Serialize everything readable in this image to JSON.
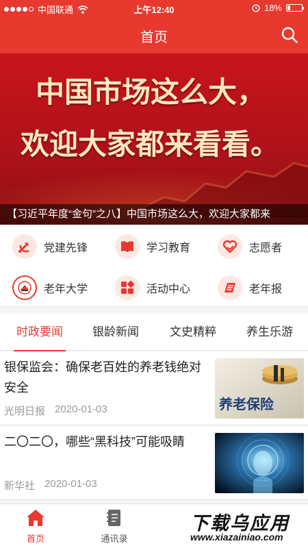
{
  "status_bar": {
    "carrier": "中国联通",
    "time": "上午12:40",
    "battery": "18%"
  },
  "header": {
    "title": "首页"
  },
  "banner": {
    "headline_line1": "中国市场这么大，",
    "headline_line2": "欢迎大家都来看看。",
    "caption": "【习近平年度“金句”之八】中国市场这么大，欢迎大家都来"
  },
  "shortcuts": [
    {
      "label": "党建先锋",
      "icon": "party-emblem-icon"
    },
    {
      "label": "学习教育",
      "icon": "book-icon"
    },
    {
      "label": "志愿者",
      "icon": "heart-hands-icon"
    },
    {
      "label": "老年大学",
      "icon": "university-emblem-icon"
    },
    {
      "label": "活动中心",
      "icon": "activity-grid-icon"
    },
    {
      "label": "老年报",
      "icon": "newspaper-icon"
    }
  ],
  "tabs": [
    {
      "label": "时政要闻",
      "active": true
    },
    {
      "label": "银龄新闻",
      "active": false
    },
    {
      "label": "文史精粹",
      "active": false
    },
    {
      "label": "养生乐游",
      "active": false
    }
  ],
  "news": [
    {
      "title": "银保监会：确保老百姓的养老钱绝对安全",
      "source": "光明日报",
      "date": "2020-01-03",
      "thumb_text": "养老保险"
    },
    {
      "title": "二〇二〇，哪些“黑科技”可能吸睛",
      "source": "新华社",
      "date": "2020-01-03"
    }
  ],
  "bottom_nav": [
    {
      "label": "首页",
      "active": true
    },
    {
      "label": "通讯录",
      "active": false
    }
  ],
  "watermark": {
    "line1": "下载乌应用",
    "line2": "www.xiazainiao.com"
  },
  "colors": {
    "accent": "#e8392f",
    "text": "#333333",
    "muted": "#999999"
  }
}
